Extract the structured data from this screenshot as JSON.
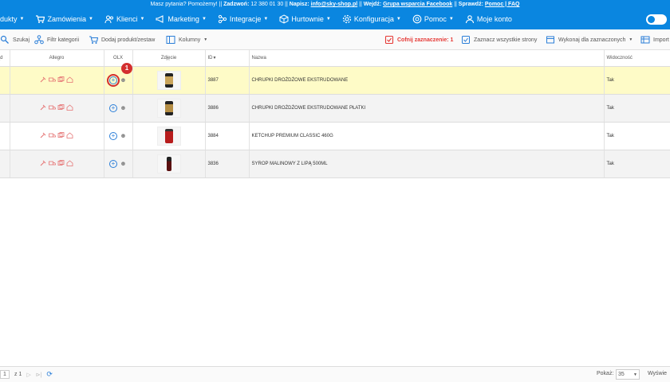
{
  "topbar": {
    "question": "Masz pytania? Pomożemy!",
    "call_label": "Zadzwoń:",
    "call_value": "12 380 01 30",
    "write_label": "Napisz:",
    "write_value": "info@sky-shop.pl",
    "join_label": "Wejdź:",
    "join_value": "Grupa wsparcia Facebook",
    "check_label": "Sprawdź:",
    "check_value": "Pomoc | FAQ"
  },
  "nav": {
    "items": [
      {
        "label": "dukty"
      },
      {
        "label": "Zamówienia"
      },
      {
        "label": "Klienci"
      },
      {
        "label": "Marketing"
      },
      {
        "label": "Integracje"
      },
      {
        "label": "Hurtownie"
      },
      {
        "label": "Konfiguracja"
      },
      {
        "label": "Pomoc"
      },
      {
        "label": "Moje konto"
      }
    ]
  },
  "toolbar": {
    "search": "Szukaj",
    "filter": "Filtr kategorii",
    "add": "Dodaj produkt/zestaw",
    "columns": "Kolumny",
    "undo": "Cofnij zaznaczenie: 1",
    "select_all": "Zaznacz wszystkie strony",
    "do_selected": "Wykonaj dla zaznaczonych",
    "import": "Import"
  },
  "table": {
    "headers": {
      "first": "ąd",
      "allegro": "Allegro",
      "olx": "OLX",
      "photo": "Zdjęcie",
      "id": "ID",
      "name": "Nazwa",
      "visibility": "Widoczność"
    },
    "rows": [
      {
        "id": "3887",
        "name": "CHRUPKI DROŻDŻOWE EKSTRUDOWANE",
        "visibility": "Tak"
      },
      {
        "id": "3886",
        "name": "CHRUPKI DROŻDŻOWE EKSTRUDOWANE PŁATKI",
        "visibility": "Tak"
      },
      {
        "id": "3884",
        "name": "KETCHUP PREMIUM CLASSIC 460G",
        "visibility": "Tak"
      },
      {
        "id": "3836",
        "name": "SYROP MALINOWY Z LIPĄ 500ML",
        "visibility": "Tak"
      }
    ]
  },
  "annotation": {
    "badge": "1"
  },
  "footer": {
    "page": "1",
    "of": "z 1",
    "show_label": "Pokaż:",
    "show_value": "35",
    "display_label": "Wyświe"
  },
  "colors": {
    "brand": "#0a86e0",
    "highlight": "#fefbc7",
    "alert": "#e53935"
  }
}
